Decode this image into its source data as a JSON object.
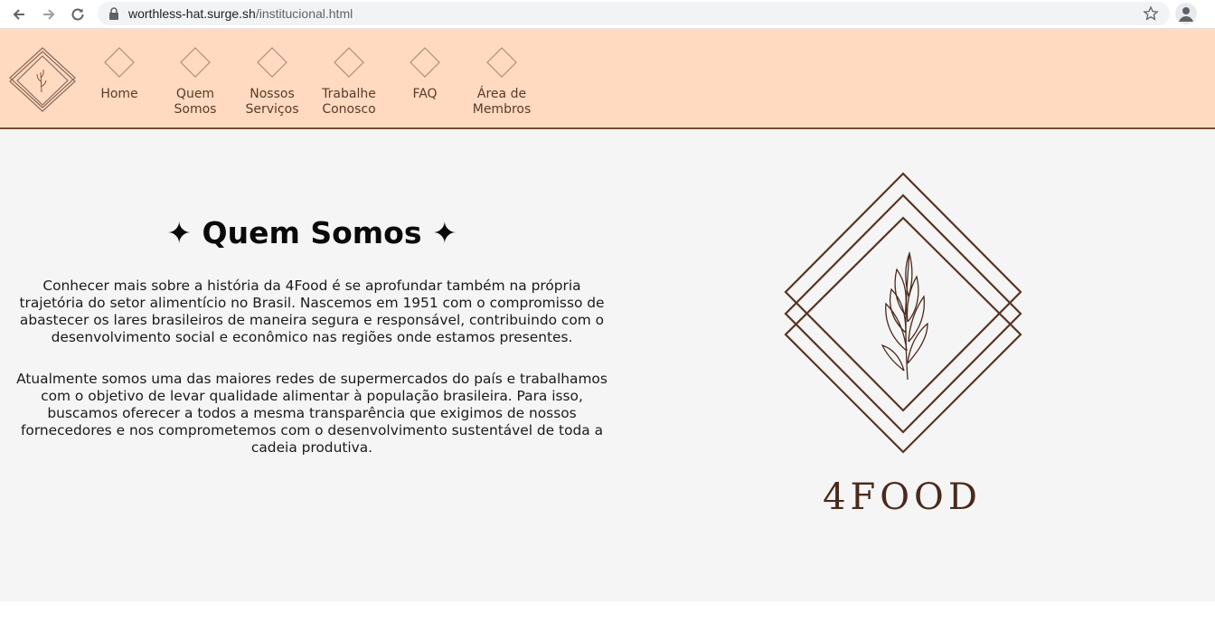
{
  "browser": {
    "url_host": "worthless-hat.surge.sh",
    "url_path": "/institucional.html"
  },
  "nav": {
    "items": [
      {
        "label": "Home"
      },
      {
        "label": "Quem Somos"
      },
      {
        "label": "Nossos Serviços"
      },
      {
        "label": "Trabalhe Conosco"
      },
      {
        "label": "FAQ"
      },
      {
        "label": "Área de Membros"
      }
    ]
  },
  "main": {
    "title": "✦ Quem Somos ✦",
    "paragraph1": "Conhecer mais sobre a história da 4Food é se aprofundar também na própria trajetória do setor alimentício no Brasil. Nascemos em 1951 com o compromisso de abastecer os lares brasileiros de maneira segura e responsável, contribuindo com o desenvolvimento social e econômico nas regiões onde estamos presentes.",
    "paragraph2": "Atualmente somos uma das maiores redes de supermercados do país e trabalhamos com o objetivo de levar qualidade alimentar à população brasileira. Para isso, buscamos oferecer a todos a mesma transparência que exigimos de nossos fornecedores e nos comprometemos com o desenvolvimento sustentável de toda a cadeia produtiva.",
    "brand": "4FOOD"
  },
  "colors": {
    "header_bg": "#ffdac0",
    "accent_brown": "#5b3a2a",
    "main_bg": "#f5f5f5"
  },
  "icons": [
    "back-arrow-icon",
    "forward-arrow-icon",
    "reload-icon",
    "lock-icon",
    "star-icon",
    "profile-icon",
    "diamond-icon",
    "leaf-icon"
  ]
}
